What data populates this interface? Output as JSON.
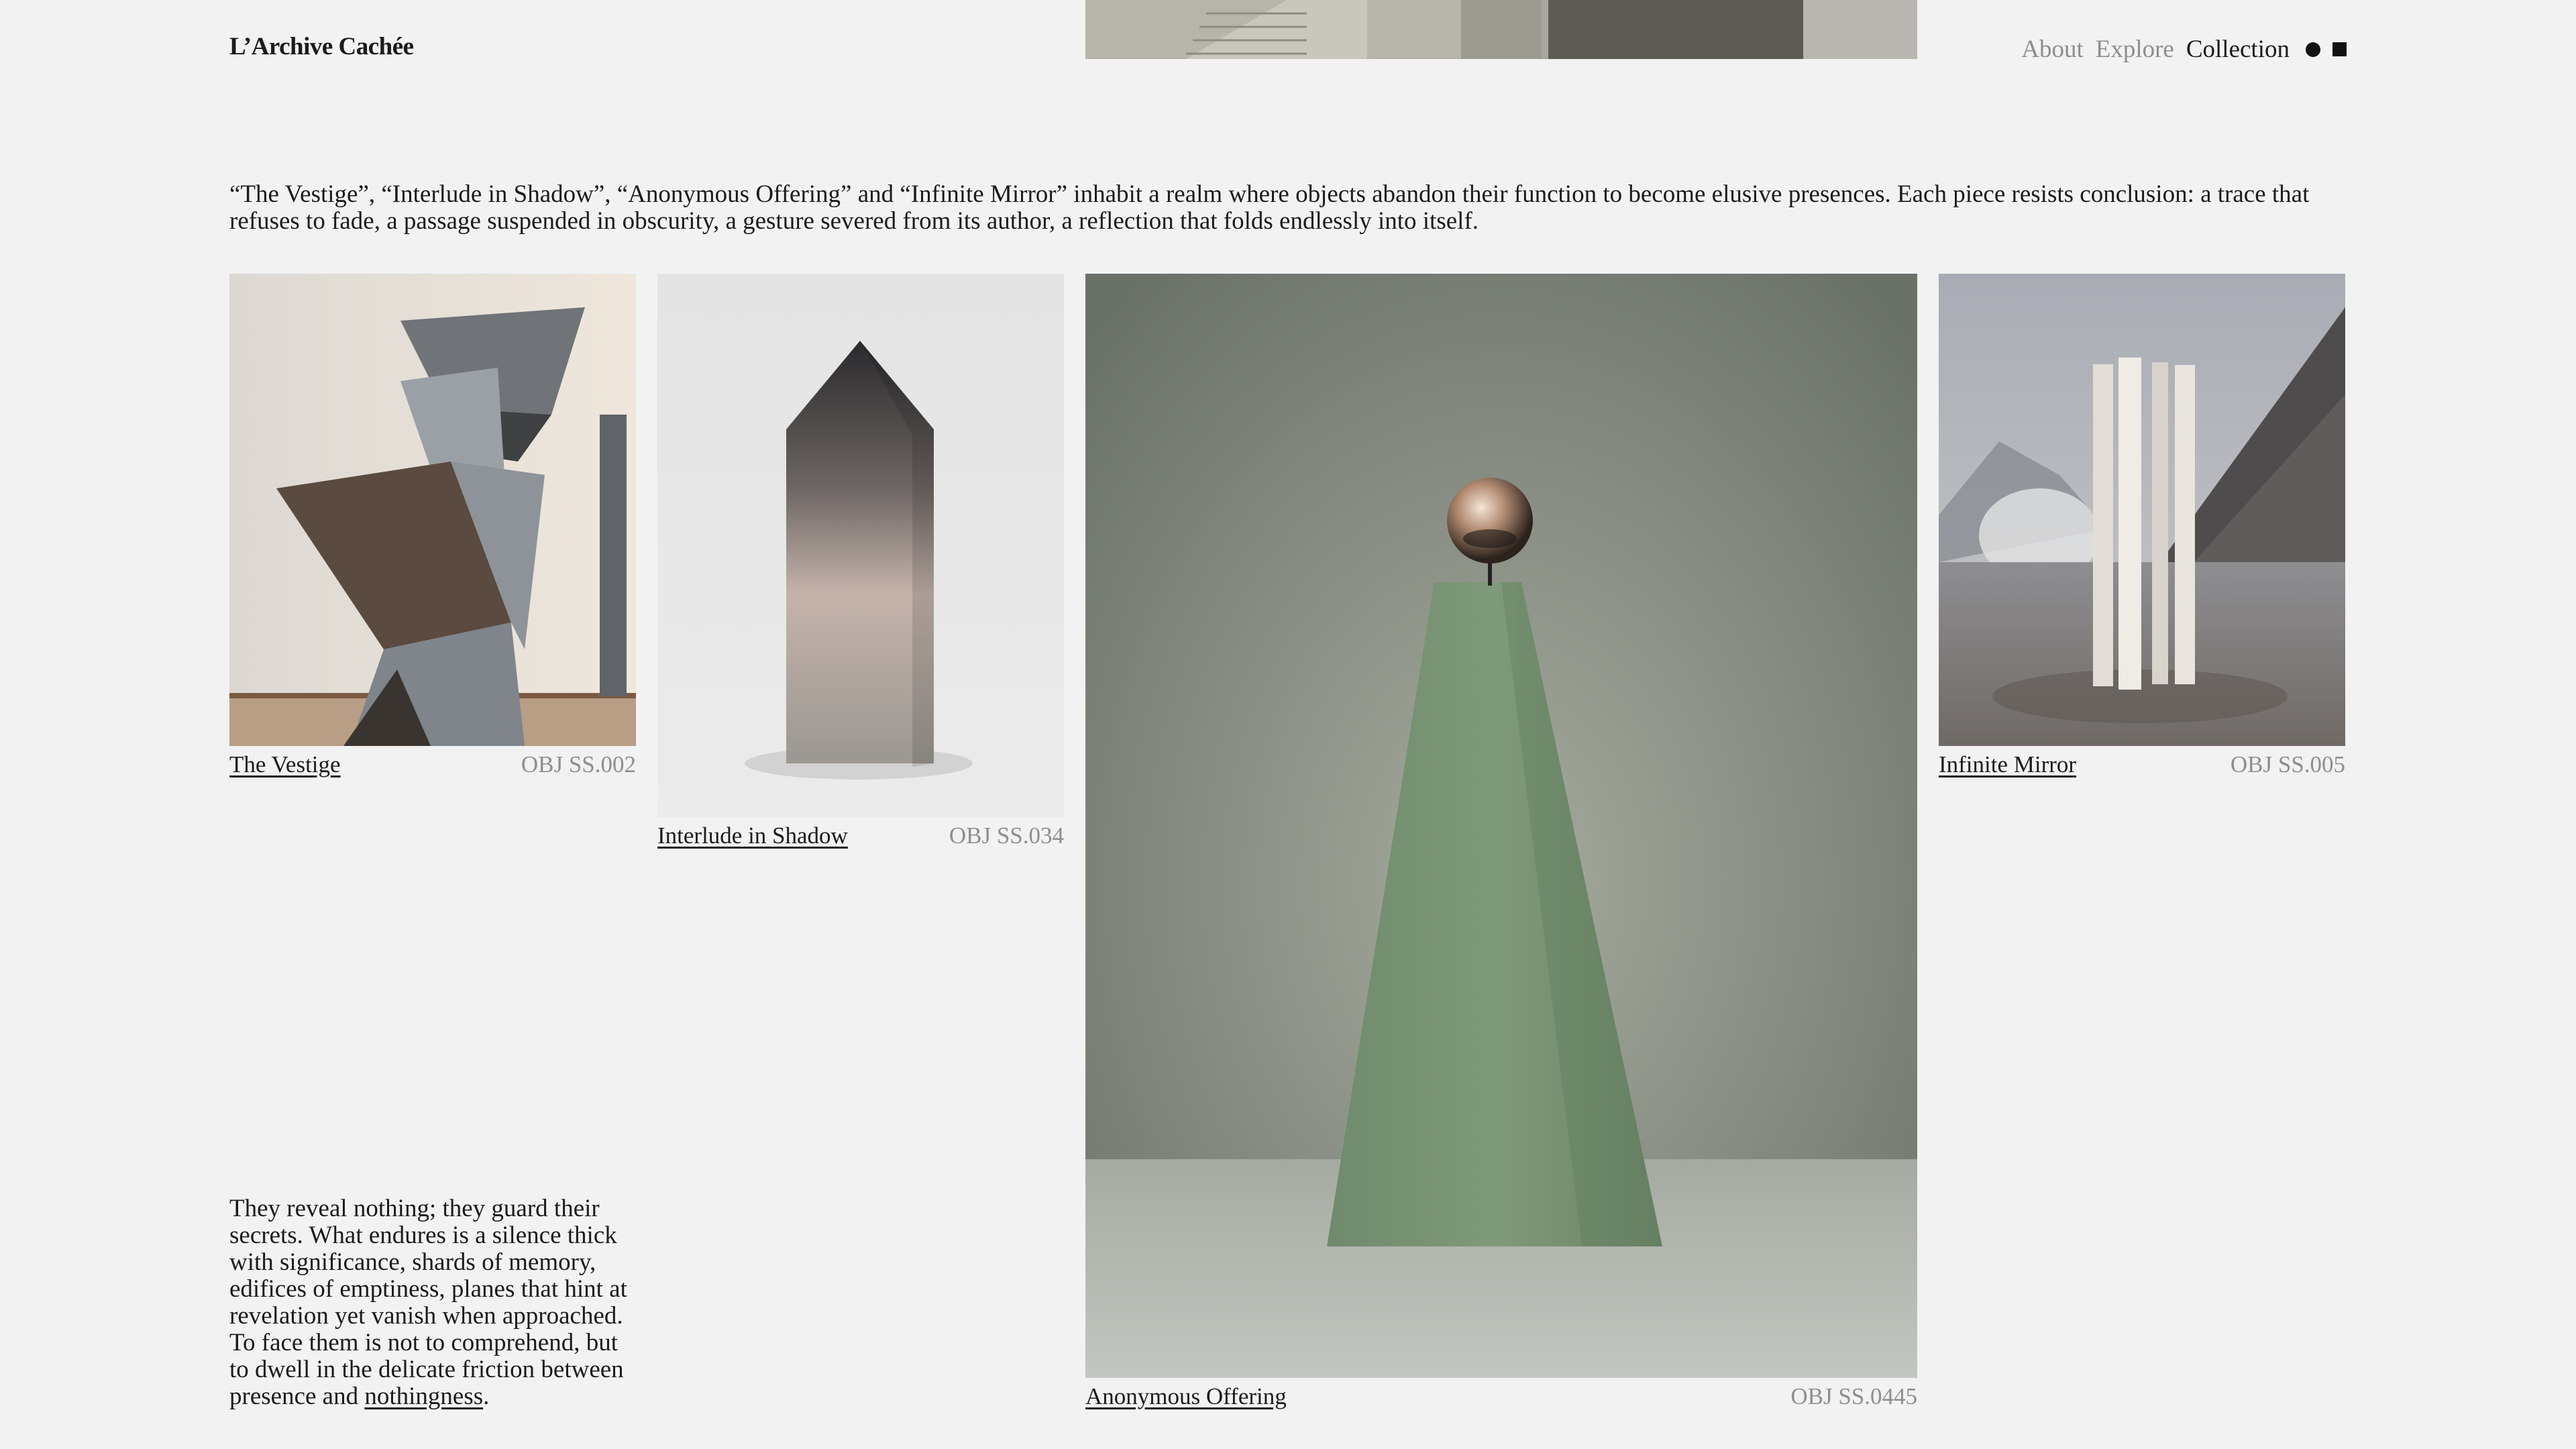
{
  "header": {
    "logo": "L’Archive Cachée",
    "nav": [
      "About",
      "Explore",
      "Collection"
    ]
  },
  "intro": "“The Vestige”, “Interlude in Shadow”, “Anonymous Offering” and “Infinite Mirror” inhabit a realm where objects abandon their function to become elusive presences. Each piece resists conclusion: a trace that refuses to fade, a passage suspended in obscurity, a gesture severed from its author, a reflection that folds endlessly into itself.",
  "items": [
    {
      "title": "The Vestige",
      "code": "OBJ SS.002"
    },
    {
      "title": "Interlude in Shadow",
      "code": "OBJ SS.034"
    },
    {
      "title": "Anonymous Offering",
      "code": "OBJ SS.0445"
    },
    {
      "title": "Infinite Mirror",
      "code": "OBJ SS.005"
    }
  ],
  "outro": {
    "text": "They reveal nothing; they guard their secrets. What endures is a silence thick with significance, shards of memory, edifices of emptiness, planes that hint at revelation yet vanish when approached. To face them is not to comprehend, but to dwell in the delicate friction between presence and ",
    "link": "nothingness",
    "end": "."
  }
}
